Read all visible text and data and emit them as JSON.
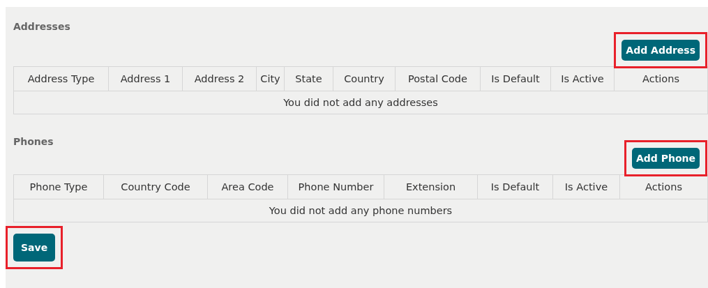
{
  "sections": [
    {
      "heading": "Addresses",
      "button": "Add Address",
      "highlighted": true,
      "columns": [
        "Address Type",
        "Address 1",
        "Address 2",
        "City",
        "State",
        "Country",
        "Postal Code",
        "Is Default",
        "Is Active",
        "Actions"
      ],
      "empty_message": "You did not add any addresses"
    },
    {
      "heading": "Phones",
      "button": "Add Phone",
      "highlighted": true,
      "columns": [
        "Phone Type",
        "Country Code",
        "Area Code",
        "Phone Number",
        "Extension",
        "Is Default",
        "Is Active",
        "Actions"
      ],
      "empty_message": "You did not add any phone numbers"
    }
  ],
  "save_button": {
    "label": "Save",
    "highlighted": true
  }
}
